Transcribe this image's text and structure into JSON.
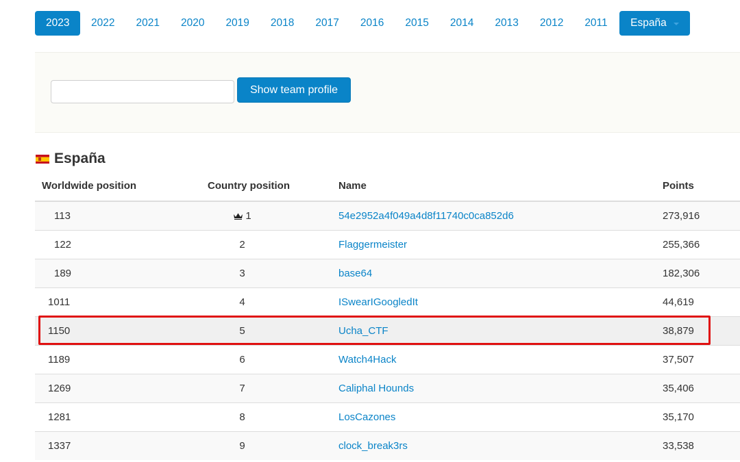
{
  "years": [
    "2023",
    "2022",
    "2021",
    "2020",
    "2019",
    "2018",
    "2017",
    "2016",
    "2015",
    "2014",
    "2013",
    "2012",
    "2011"
  ],
  "active_year": "2023",
  "country_selector": {
    "label": "España",
    "icon": "caret-down-icon"
  },
  "search": {
    "value": "",
    "placeholder": "",
    "button_label": "Show team profile"
  },
  "section": {
    "title": "España",
    "flag_icon": "spain-flag-icon"
  },
  "table": {
    "headers": [
      "Worldwide position",
      "Country position",
      "Name",
      "Points"
    ],
    "rows": [
      {
        "worldwide": "113",
        "country": "1",
        "crown": true,
        "name": "54e2952a4f049a4d8f11740c0ca852d6",
        "points": "273,916"
      },
      {
        "worldwide": "122",
        "country": "2",
        "crown": false,
        "name": "Flaggermeister",
        "points": "255,366"
      },
      {
        "worldwide": "189",
        "country": "3",
        "crown": false,
        "name": "base64",
        "points": "182,306"
      },
      {
        "worldwide": "1011",
        "country": "4",
        "crown": false,
        "name": "ISwearIGoogledIt",
        "points": "44,619"
      },
      {
        "worldwide": "1150",
        "country": "5",
        "crown": false,
        "name": "Ucha_CTF",
        "points": "38,879",
        "highlighted": true
      },
      {
        "worldwide": "1189",
        "country": "6",
        "crown": false,
        "name": "Watch4Hack",
        "points": "37,507"
      },
      {
        "worldwide": "1269",
        "country": "7",
        "crown": false,
        "name": "Caliphal Hounds",
        "points": "35,406"
      },
      {
        "worldwide": "1281",
        "country": "8",
        "crown": false,
        "name": "LosCazones",
        "points": "35,170"
      },
      {
        "worldwide": "1337",
        "country": "9",
        "crown": false,
        "name": "clock_break3rs",
        "points": "33,538"
      }
    ]
  },
  "colors": {
    "accent": "#0a84c8",
    "highlight_border": "#e01010"
  }
}
